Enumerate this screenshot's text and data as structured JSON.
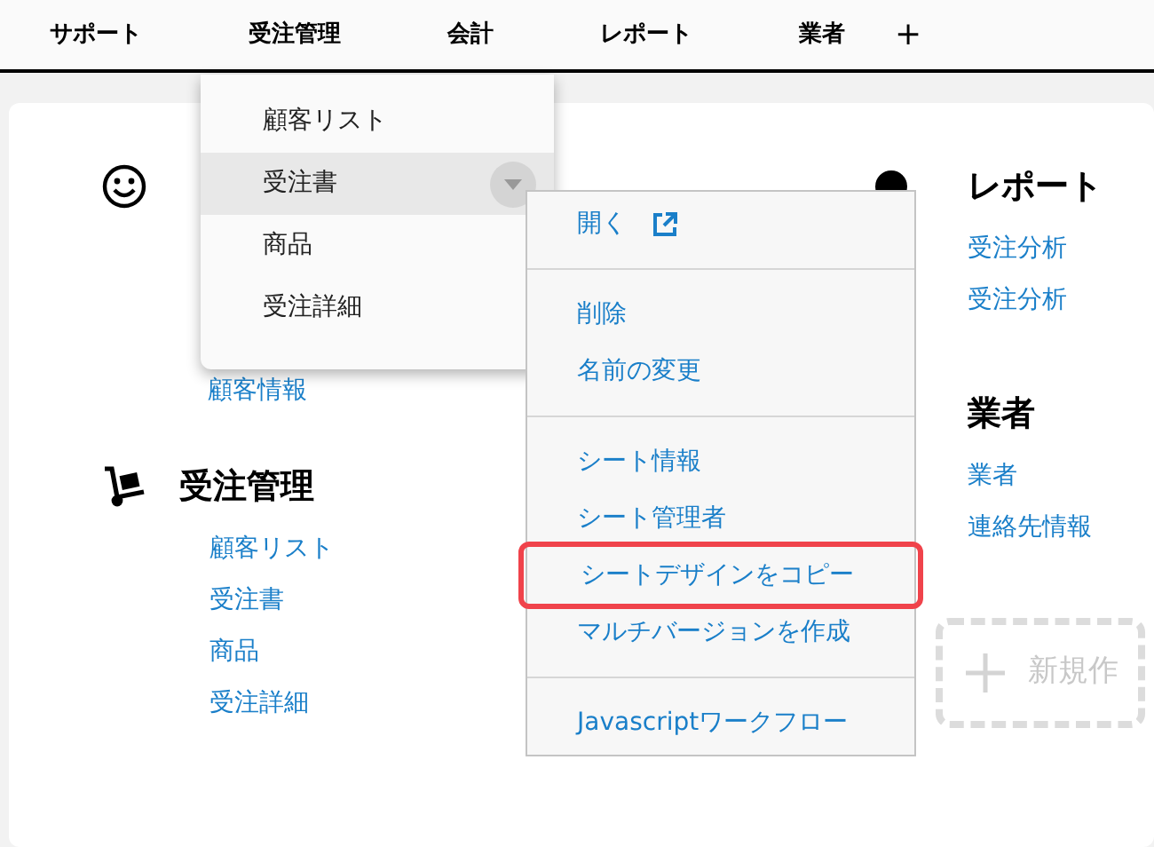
{
  "nav": {
    "items": [
      "サポート",
      "受注管理",
      "会計",
      "レポート",
      "業者"
    ],
    "add": "+"
  },
  "sections_left": [
    {
      "links": [
        "顧客情報"
      ]
    },
    {
      "title": "受注管理",
      "links": [
        "顧客リスト",
        "受注書",
        "商品",
        "受注詳細"
      ]
    }
  ],
  "sections_right": [
    {
      "title": "レポート",
      "links": [
        "受注分析",
        "受注分析"
      ]
    },
    {
      "title": "業者",
      "links": [
        "業者",
        "連絡先情報"
      ]
    }
  ],
  "new_button": {
    "label": "新規作"
  },
  "dropdown": {
    "items": [
      {
        "label": "顧客リスト",
        "selected": false
      },
      {
        "label": "受注書",
        "selected": true
      },
      {
        "label": "商品",
        "selected": false
      },
      {
        "label": "受注詳細",
        "selected": false
      }
    ]
  },
  "context_menu": {
    "groups": [
      [
        {
          "label": "開く",
          "kind": "open",
          "highlighted": false
        }
      ],
      [
        {
          "label": "削除",
          "kind": "plain",
          "highlighted": false
        },
        {
          "label": "名前の変更",
          "kind": "plain",
          "highlighted": false
        }
      ],
      [
        {
          "label": "シート情報",
          "kind": "plain",
          "highlighted": false
        },
        {
          "label": "シート管理者",
          "kind": "plain",
          "highlighted": false
        },
        {
          "label": "シートデザインをコピー",
          "kind": "plain",
          "highlighted": true
        },
        {
          "label": "マルチバージョンを作成",
          "kind": "plain",
          "highlighted": false
        }
      ],
      [
        {
          "label": "Javascriptワークフロー",
          "kind": "plain",
          "highlighted": false
        }
      ]
    ]
  }
}
